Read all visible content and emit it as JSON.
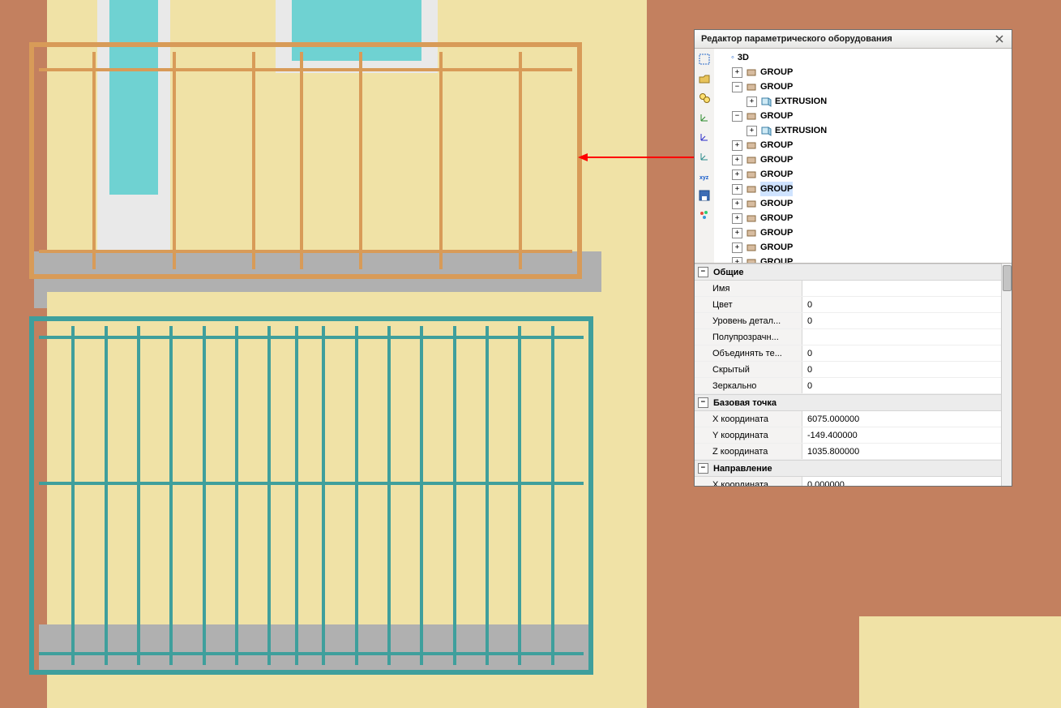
{
  "panel": {
    "title": "Редактор параметрического оборудования"
  },
  "tree": {
    "root3d": "3D",
    "group": "GROUP",
    "extrusion": "EXTRUSION"
  },
  "props": {
    "sections": {
      "common": "Общие",
      "basept": "Базовая точка",
      "direction": "Направление"
    },
    "rows": {
      "name": {
        "label": "Имя",
        "value": ""
      },
      "color": {
        "label": "Цвет",
        "value": "0"
      },
      "detail": {
        "label": "Уровень детал...",
        "value": "0"
      },
      "alpha": {
        "label": "Полупрозрачн...",
        "value": ""
      },
      "merge": {
        "label": "Объединять те...",
        "value": "0"
      },
      "hidden": {
        "label": "Скрытый",
        "value": "0"
      },
      "mirror": {
        "label": "Зеркально",
        "value": "0"
      },
      "xcoord": {
        "label": "X координата",
        "value": "6075.000000"
      },
      "ycoord": {
        "label": "Y координата",
        "value": "-149.400000"
      },
      "zcoord": {
        "label": "Z координата",
        "value": "1035.800000"
      },
      "dir_x": {
        "label": "X координата",
        "value": "0.000000"
      }
    }
  }
}
